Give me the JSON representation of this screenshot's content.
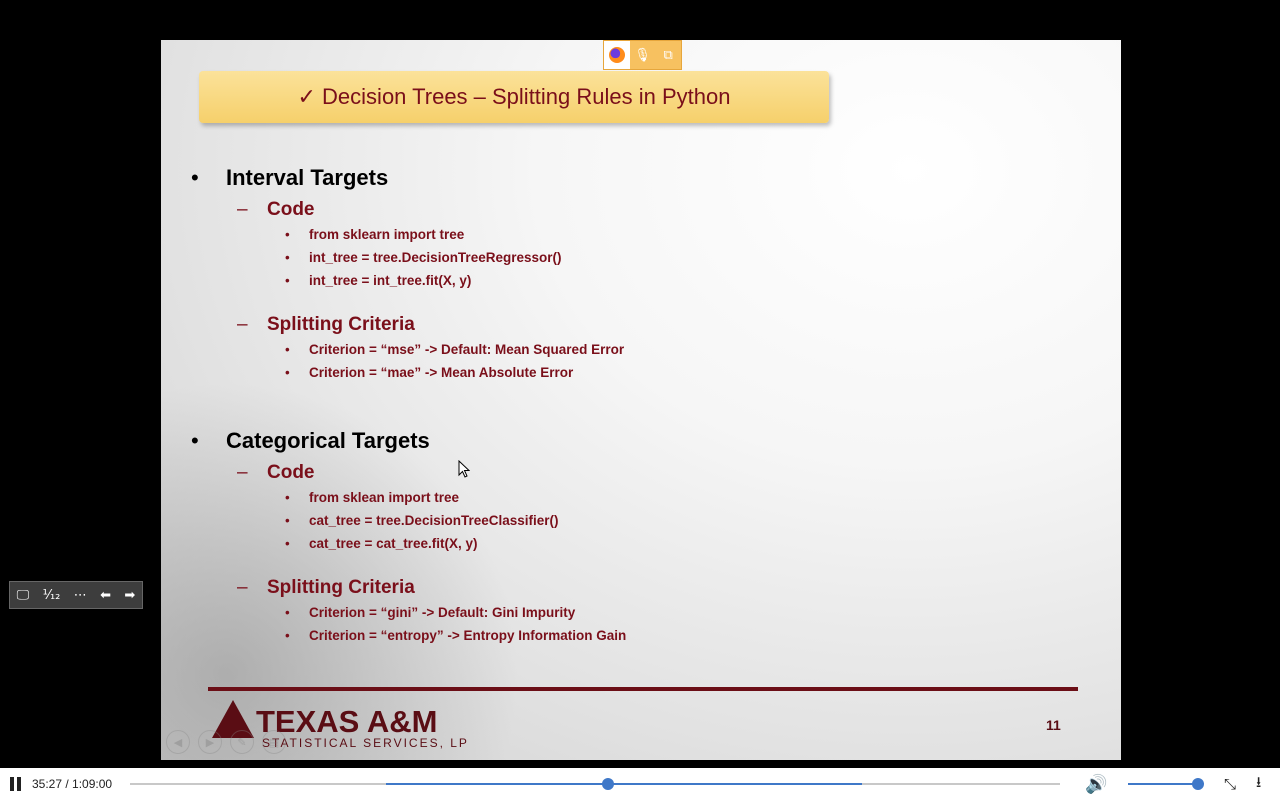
{
  "slide": {
    "title": "✓ Decision Trees – Splitting Rules in Python",
    "sections": [
      {
        "heading": "Interval Targets",
        "subs": [
          {
            "heading": "Code",
            "items": [
              "from sklearn import tree",
              "int_tree = tree.DecisionTreeRegressor()",
              "int_tree = int_tree.fit(X, y)"
            ]
          },
          {
            "heading": "Splitting Criteria",
            "items": [
              "Criterion = “mse” -> Default: Mean Squared Error",
              "Criterion = “mae” -> Mean Absolute Error"
            ]
          }
        ]
      },
      {
        "heading": "Categorical Targets",
        "subs": [
          {
            "heading": "Code",
            "items": [
              "from sklean import tree",
              "cat_tree = tree.DecisionTreeClassifier()",
              "cat_tree = cat_tree.fit(X, y)"
            ]
          },
          {
            "heading": "Splitting Criteria",
            "items": [
              "Criterion = “gini” -> Default: Gini Impurity",
              "Criterion = “entropy” -> Entropy Information Gain"
            ]
          }
        ]
      }
    ],
    "logo_main": "TEXAS A&M",
    "logo_sub": "STATISTICAL SERVICES, LP",
    "page_number": "11"
  },
  "mini_toolbar": {
    "icons": [
      "firefox-icon",
      "microphone-icon",
      "screen-share-icon"
    ]
  },
  "side_toolbar": {
    "icons": [
      "screen-icon",
      "fraction-icon",
      "more-icon",
      "prev-arrow-icon",
      "next-arrow-icon"
    ],
    "fraction_text": "¹⁄₁₂"
  },
  "player": {
    "time_display": "35:27 / 1:09:00",
    "progress_fraction": 0.514,
    "volume_fraction": 0.99
  },
  "colors": {
    "accent": "#3f78c8",
    "slide_text": "#7a0f1a",
    "title_bg": "#f6d06b"
  }
}
